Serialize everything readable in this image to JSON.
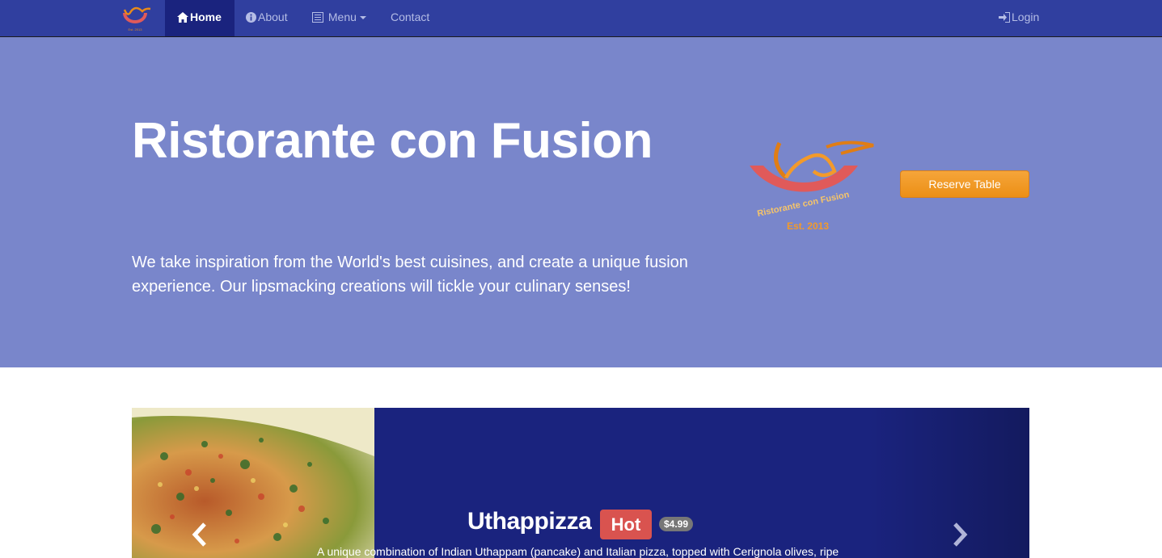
{
  "brand": {
    "logo_name": "ristorante-logo-small"
  },
  "nav": {
    "home": "Home",
    "about": "About",
    "menu": "Menu",
    "contact": "Contact",
    "login": "Login"
  },
  "jumbotron": {
    "title": "Ristorante con Fusion",
    "text": "We take inspiration from the World's best cuisines, and create a unique fusion experience. Our lipsmacking creations will tickle your culinary senses!",
    "logo_text": "Ristorante con Fusion",
    "logo_est": "Est. 2013",
    "reserve_button": "Reserve Table"
  },
  "carousel": {
    "title": "Uthappizza",
    "label": "Hot",
    "price": "$4.99",
    "description": "A unique combination of Indian Uthappam (pancake) and Italian pizza, topped with Cerignola olives, ripe"
  },
  "colors": {
    "navbar": "#303f9f",
    "nav_active": "#1a237e",
    "jumbotron": "#7986cb",
    "reserve_button": "#f0a030",
    "carousel_bg": "#1a237e",
    "hot_label": "#d9534f"
  }
}
